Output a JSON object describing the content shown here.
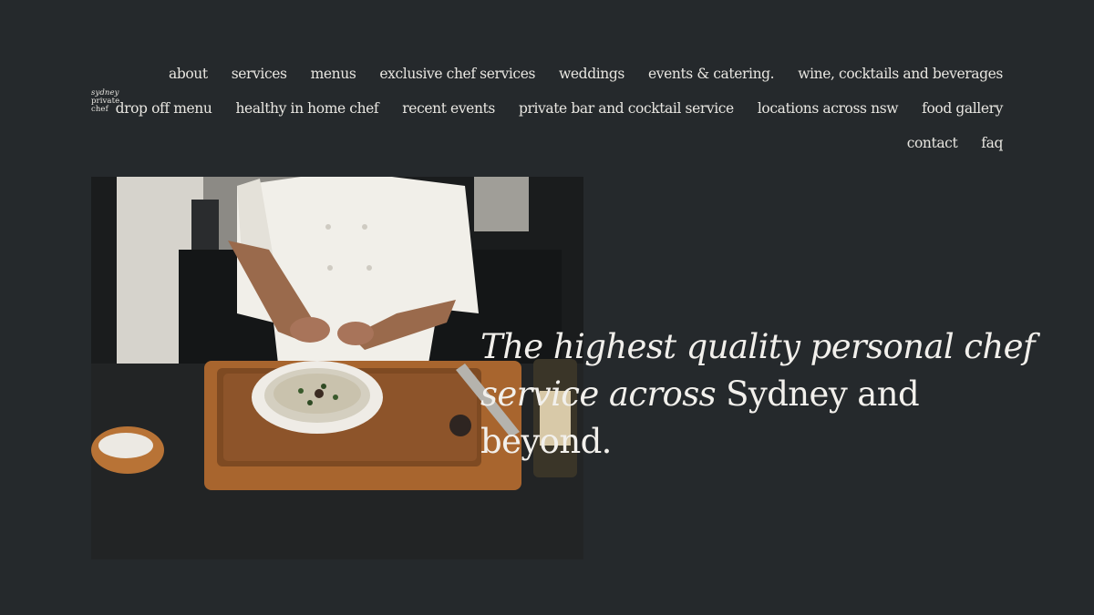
{
  "logo": {
    "line1": "sydney",
    "line2": "private",
    "line3": "chef"
  },
  "nav": {
    "row1": [
      "about",
      "services",
      "menus",
      "exclusive chef services",
      "weddings",
      "events & catering.",
      "wine, cocktails and beverages"
    ],
    "row2": [
      "drop off menu",
      "healthy in home chef",
      "recent events",
      "private bar and cocktail service",
      "locations across nsw",
      "food gallery"
    ],
    "row3": [
      "contact",
      "faq"
    ]
  },
  "hero": {
    "headline_italic": "The highest quality personal chef service across",
    "headline_regular": " Sydney and beyond."
  },
  "colors": {
    "background": "#25292c",
    "text": "#e8e6e1"
  }
}
